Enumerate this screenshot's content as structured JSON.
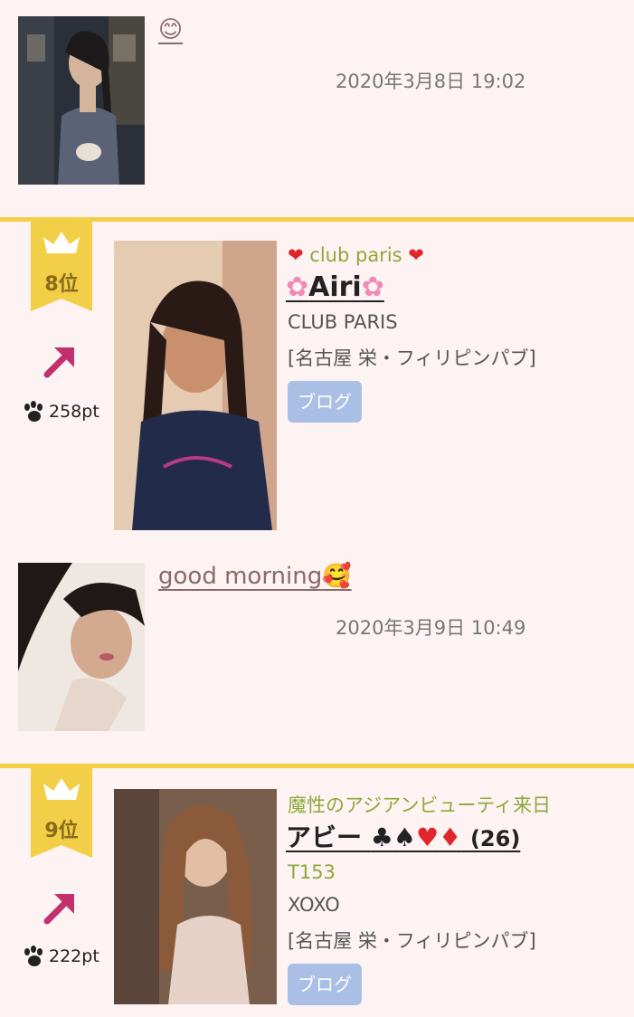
{
  "posts": [
    {
      "text": "😊",
      "date": "2020年3月8日 19:02"
    },
    {
      "text": "good morning",
      "date": "2020年3月9日 10:49"
    }
  ],
  "rankings": [
    {
      "rank": "8位",
      "trend": "up",
      "points": "258pt",
      "tagline": "club paris",
      "name": "Airi",
      "shop": "CLUB PARIS",
      "location": "[名古屋 栄・フィリピンパブ]",
      "blog_label": "ブログ"
    },
    {
      "rank": "9位",
      "trend": "up",
      "points": "222pt",
      "tagline": "魔性のアジアンビューティ来日",
      "name": "アビー",
      "age": "(26)",
      "height": "T153",
      "shop": "XOXO",
      "location": "[名古屋 栄・フィリピンパブ]",
      "blog_label": "ブログ"
    }
  ],
  "colors": {
    "background": "#fdf3f3",
    "divider": "#f2cf46",
    "accent_green": "#8ea83a",
    "arrow": "#c2306e",
    "blog_button": "#a9bfe6"
  }
}
